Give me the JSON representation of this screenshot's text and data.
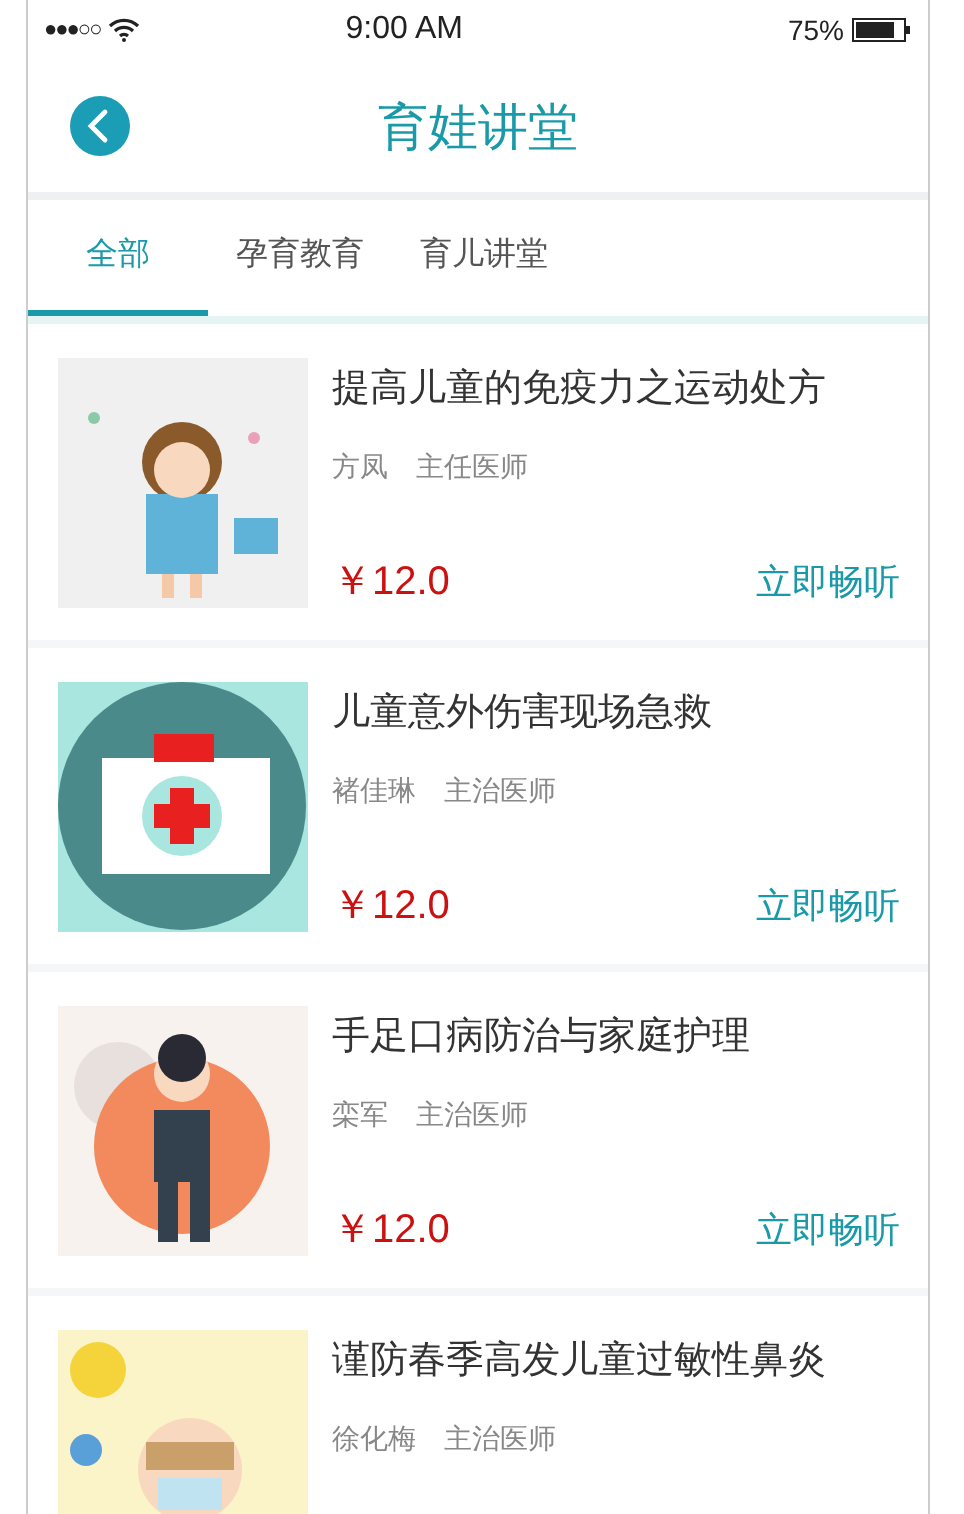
{
  "status_bar": {
    "signal_dots": "●●●○○",
    "time": "9:00 AM",
    "battery": "75%"
  },
  "header": {
    "title": "育娃讲堂"
  },
  "tabs": [
    {
      "label": "全部",
      "selected": true
    },
    {
      "label": "孕育教育",
      "selected": false
    },
    {
      "label": "育儿讲堂",
      "selected": false
    }
  ],
  "courses": [
    {
      "title": "提高儿童的免疫力之运动处方",
      "teacher": "方凤",
      "rank": "主任医师",
      "price": "￥12.0",
      "action": "立即畅听"
    },
    {
      "title": "儿童意外伤害现场急救",
      "teacher": "褚佳琳",
      "rank": "主治医师",
      "price": "￥12.0",
      "action": "立即畅听"
    },
    {
      "title": "手足口病防治与家庭护理",
      "teacher": "栾军",
      "rank": "主治医师",
      "price": "￥12.0",
      "action": "立即畅听"
    },
    {
      "title": "谨防春季高发儿童过敏性鼻炎",
      "teacher": "徐化梅",
      "rank": "主治医师"
    }
  ]
}
